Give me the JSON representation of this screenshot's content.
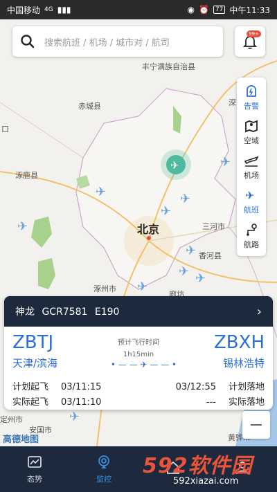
{
  "status_bar": {
    "carrier": "中国移动",
    "network": "4G",
    "battery": "77",
    "time": "中午11:33"
  },
  "search": {
    "placeholder": "搜索航班 / 机场 / 城市对 / 航司"
  },
  "alarm": {
    "badge": "99+"
  },
  "toolbar": {
    "items": [
      {
        "label": "告警",
        "icon": "alarm-bell-icon"
      },
      {
        "label": "空域",
        "icon": "map-icon"
      },
      {
        "label": "机场",
        "icon": "runway-plane-icon"
      },
      {
        "label": "航班",
        "icon": "flight-icon"
      },
      {
        "label": "航路",
        "icon": "route-icon"
      }
    ]
  },
  "map_labels": {
    "l1": "丰宁满族自治县",
    "l2": "赤城县",
    "l3": "涿鹿县",
    "l4": "北京",
    "l5": "三河市",
    "l6": "香河县",
    "l7": "涿州市",
    "l8": "廊坊",
    "l9": "安国市",
    "l10": "黄骅市",
    "l11": "深",
    "l12": "口",
    "l13": "定州市"
  },
  "flight": {
    "name": "神龙",
    "callsign": "GCR7581",
    "aircraft": "E190",
    "dep_code": "ZBTJ",
    "dep_city": "天津/滨海",
    "arr_code": "ZBXH",
    "arr_city": "锡林浩特",
    "eta_label": "预计飞行时间",
    "eta": "1h15min",
    "plan_dep_label": "计划起飞",
    "plan_dep": "03/11:15",
    "act_dep_label": "实际起飞",
    "act_dep": "03/11:10",
    "plan_arr_label": "计划落地",
    "plan_arr": "03/12:55",
    "act_arr_label": "实际落地",
    "act_arr": "---"
  },
  "map_brand": "高德地图",
  "nav": {
    "items": [
      {
        "label": "态势",
        "icon": "chart-icon"
      },
      {
        "label": "监控",
        "icon": "monitor-icon"
      },
      {
        "label": "",
        "icon": "home-icon"
      },
      {
        "label": "",
        "icon": "user-icon"
      }
    ]
  },
  "watermark": {
    "main": "592软件园",
    "sub": "592xiazai.com"
  }
}
